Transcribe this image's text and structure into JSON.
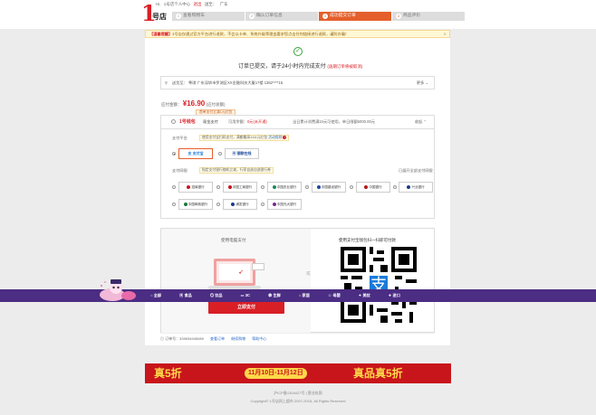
{
  "topbar": {
    "welcome": "Hi,",
    "user": "1号店个人中心",
    "logout": "退出",
    "deliver_to": "送至：",
    "region": "广东",
    "logo_num": "1",
    "logo_text": "号店"
  },
  "steps": [
    {
      "num": "1",
      "label": "查看购物车"
    },
    {
      "num": "2",
      "label": "确认订单信息"
    },
    {
      "num": "3",
      "label": "成功提交订单"
    },
    {
      "num": "4",
      "label": "商品评价"
    }
  ],
  "notice": {
    "tag": "【温馨提醒】",
    "text": "1号店仅通过官方平台进行退款，不会以卡单、系统升级等理由要求您点击任何链接进行退款，谨防诈骗！",
    "close": "✕"
  },
  "success": {
    "text": "订单已提交，请于24小时内完成支付",
    "warn": "(逾期订单将被取消)"
  },
  "address": {
    "label": "送货至：",
    "value": "粤琪 广东深圳市罗湖区XX金融科技大厦17楼 1362****15",
    "more": "更多"
  },
  "amount": {
    "label": "应付金额：",
    "value": "¥16.90",
    "note": "(应付总额)"
  },
  "reward": "首单支付立减1元红包",
  "card": {
    "brand": "1号钱包",
    "label": "现金支付",
    "balance_label": "可用余额：",
    "balance": "0元(未开通)",
    "note": "当日累计消费满24元可使用，单日限额5000.00元",
    "toggle": "收起"
  },
  "platform": {
    "label": "支付平台",
    "promo": "使用支付宝扫码支付，满额最高1111元红包",
    "promo_link": "活动规则",
    "alipay": "支付宝",
    "unionpay": "银联在线"
  },
  "bank_section": {
    "label": "支付网银",
    "promo": "指定支付银行随机立减，行家自选自选银行券",
    "collapse": "已展开全部支付网银"
  },
  "banks": [
    {
      "name": "招商银行",
      "color": "#c8151b"
    },
    {
      "name": "中国工商银行",
      "color": "#c8151b"
    },
    {
      "name": "中国农业银行",
      "color": "#1a8a5a"
    },
    {
      "name": "中国建设银行",
      "color": "#1a4a9a"
    },
    {
      "name": "中国银行",
      "color": "#b01818"
    },
    {
      "name": "兴业银行",
      "color": "#1a3a8a"
    },
    {
      "name": "中国邮政银行",
      "color": "#1a7a3a"
    },
    {
      "name": "浦发银行",
      "color": "#1a3a8a"
    },
    {
      "name": "中国光大银行",
      "color": "#7a2a8a"
    }
  ],
  "web_pay": {
    "title": "使用电脑支付",
    "button": "立即支付",
    "or": "或"
  },
  "qr_pay": {
    "title": "使用支付宝钱包扫一扫即可付款"
  },
  "order": {
    "label": "订单号：",
    "number": "339934945089",
    "view": "查看订单",
    "continue": "继续购物",
    "help": "帮助中心"
  },
  "catbar": [
    {
      "icon": "home-icon",
      "label": "全部"
    },
    {
      "icon": "food-icon",
      "label": "食品"
    },
    {
      "icon": "drink-icon",
      "label": "饮品"
    },
    {
      "icon": "tv-icon",
      "label": "3C"
    },
    {
      "icon": "fresh-icon",
      "label": "生鲜"
    },
    {
      "icon": "home-goods-icon",
      "label": "家居"
    },
    {
      "icon": "baby-icon",
      "label": "母婴"
    },
    {
      "icon": "makeup-icon",
      "label": "美妆"
    },
    {
      "icon": "imports-icon",
      "label": "进口"
    }
  ],
  "banner": {
    "left": "真5折",
    "date": "11月10日-11月12日",
    "right": "真品真5折"
  },
  "footer": {
    "line1": "沪ICP备1304427号 | 营业执照",
    "line2": "Copyright© 1号店网上超市 2007-2015, All Rights Reserved"
  },
  "colors": {
    "brand_red": "#d91f26",
    "step_active": "#e45f2b",
    "cat_bar": "#4b2d83",
    "banner": "#c8151b"
  }
}
